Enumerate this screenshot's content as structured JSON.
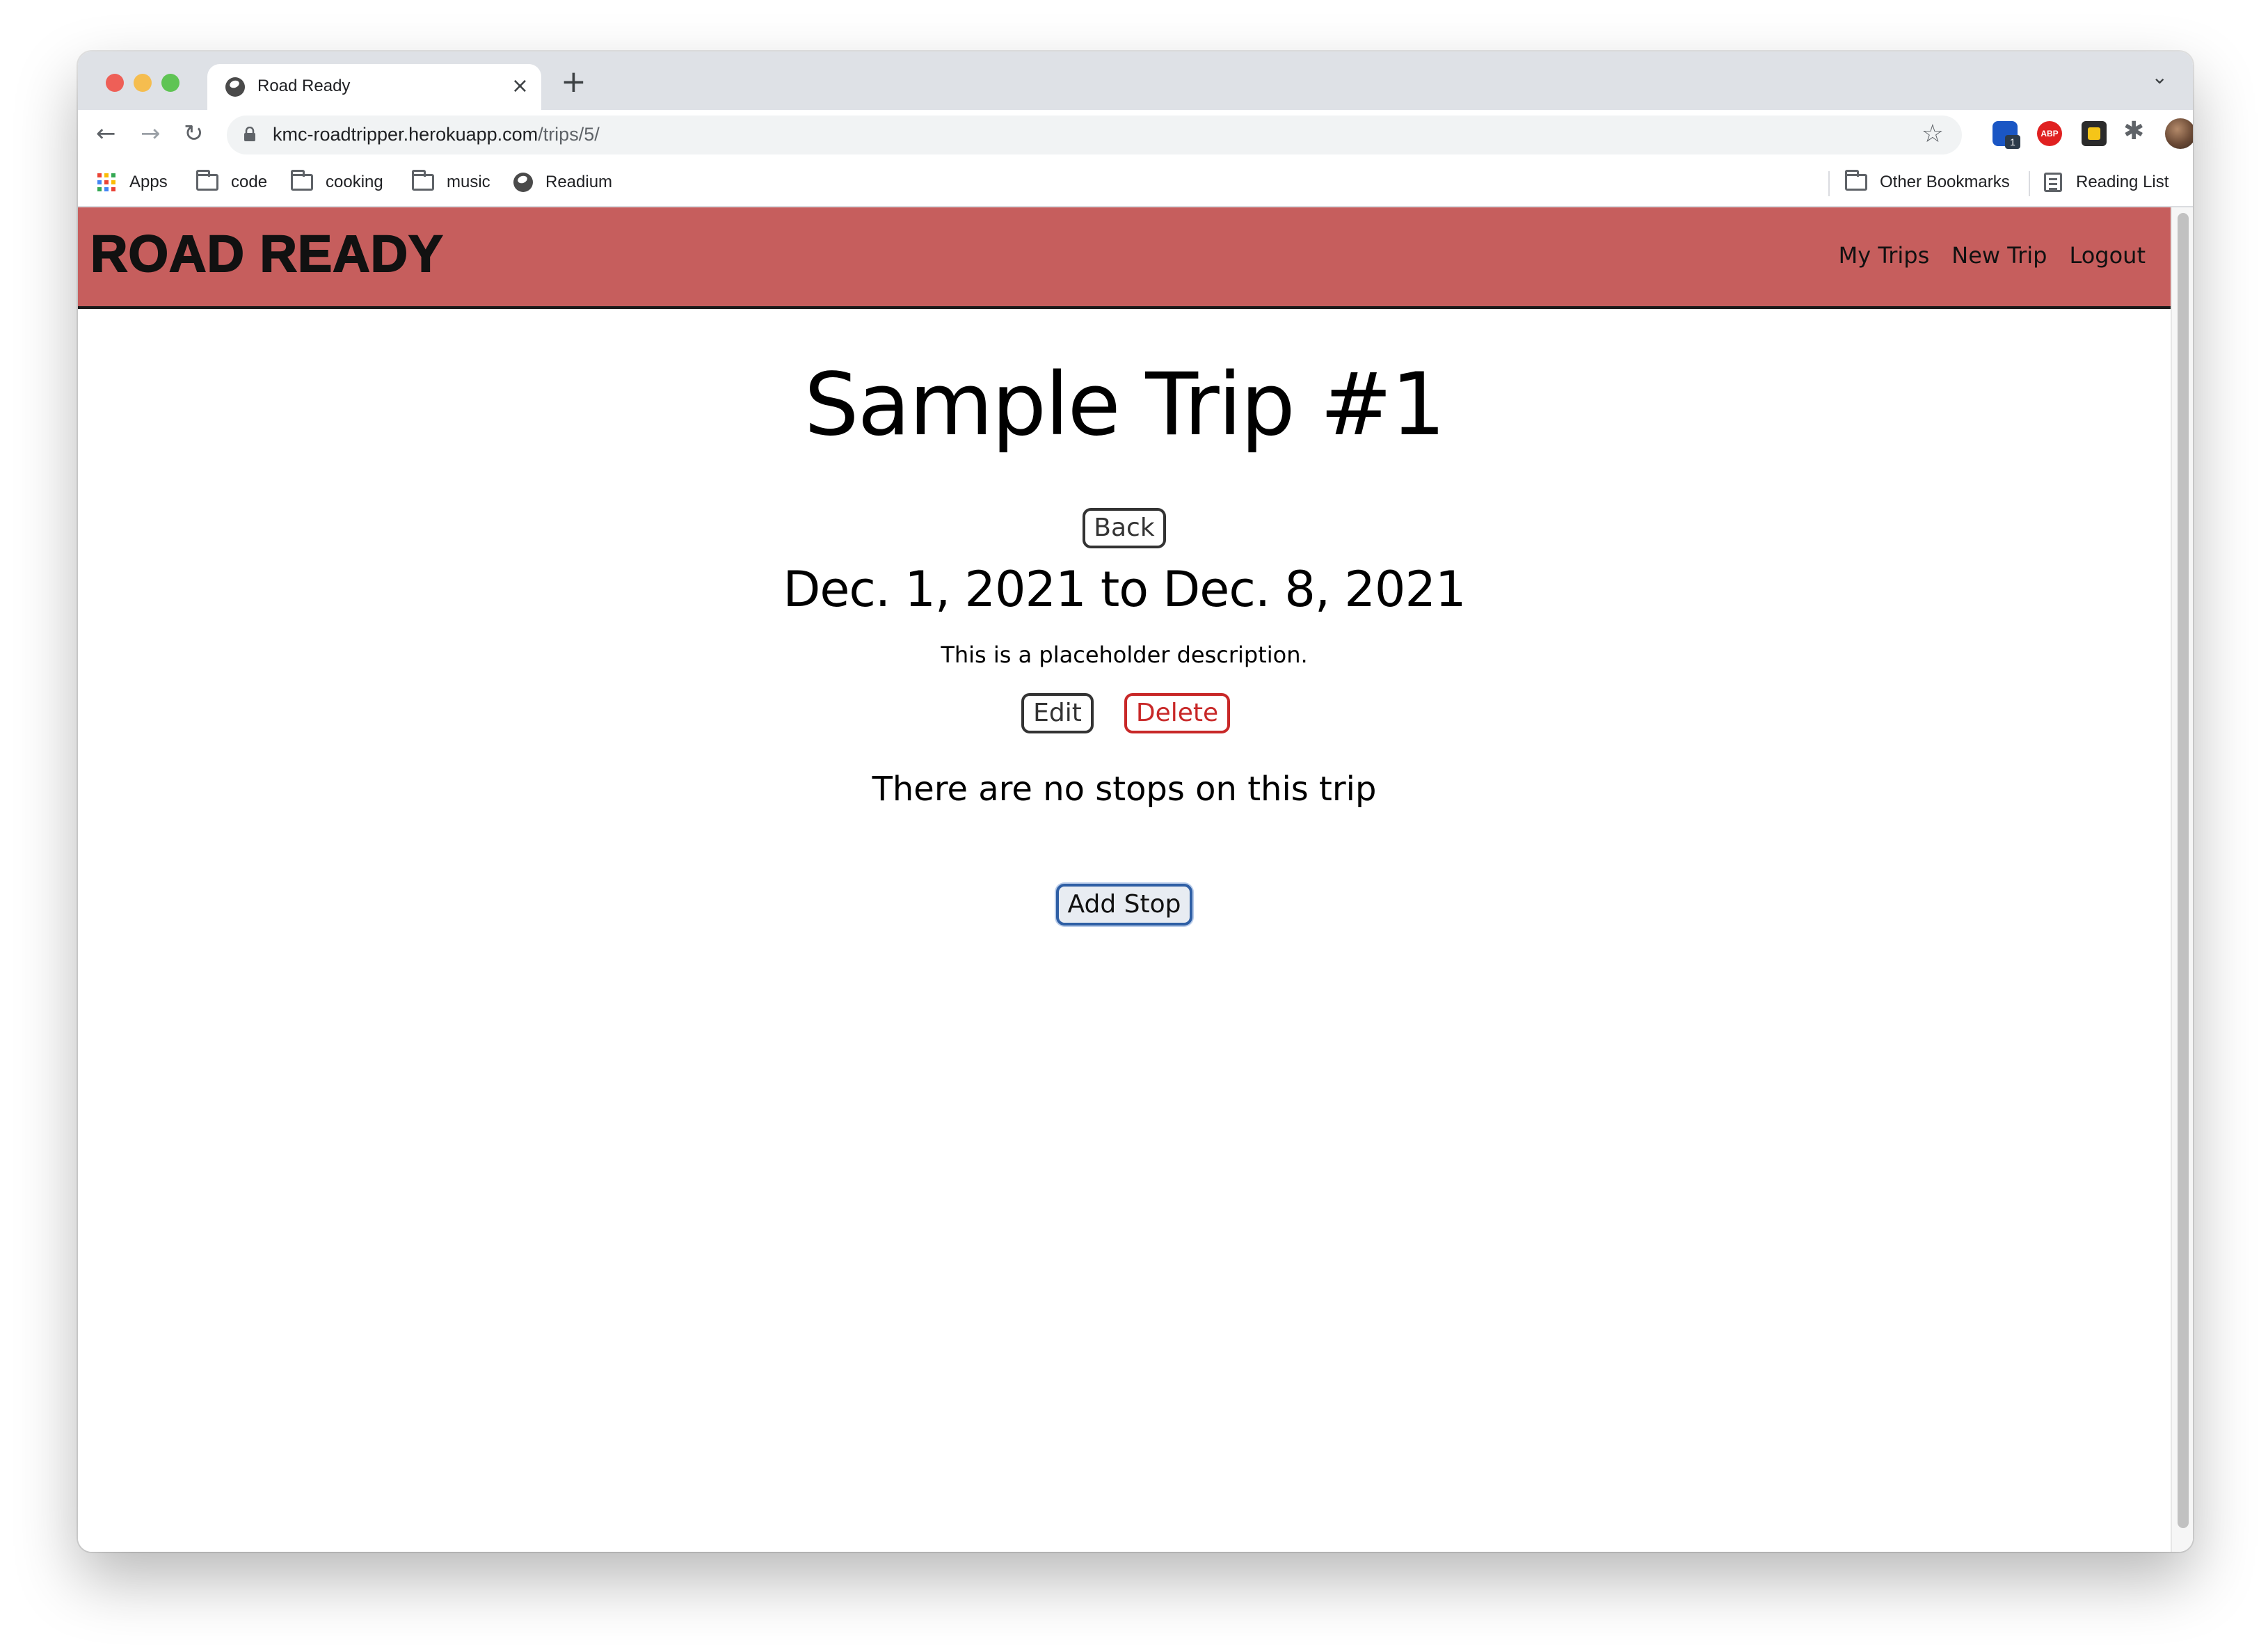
{
  "browser": {
    "tab_title": "Road Ready",
    "tab_close": "×",
    "new_tab": "+",
    "tab_menu": "⌄",
    "url_host": "kmc-roadtripper.herokuapp.com",
    "url_path": "/trips/5/",
    "back_glyph": "←",
    "forward_glyph": "→",
    "reload_glyph": "↻",
    "star_glyph": "☆",
    "puzzle_glyph": "✱",
    "kebab_glyph": "⋮",
    "ext_badge": "1",
    "ext_abp": "ABP"
  },
  "bookmarks": {
    "apps": "Apps",
    "code": "code",
    "cooking": "cooking",
    "music": "music",
    "readium": "Readium",
    "other": "Other Bookmarks",
    "reading_list": "Reading List"
  },
  "site": {
    "logo": "ROAD READY",
    "nav": {
      "my_trips": "My Trips",
      "new_trip": "New Trip",
      "logout": "Logout"
    }
  },
  "trip": {
    "title": "Sample Trip #1",
    "back_label": "Back",
    "dates": "Dec. 1, 2021 to Dec. 8, 2021",
    "description": "This is a placeholder description.",
    "edit_label": "Edit",
    "delete_label": "Delete",
    "no_stops": "There are no stops on this trip",
    "add_stop_label": "Add Stop"
  },
  "colors": {
    "header_bg": "#c65e5d",
    "delete_accent": "#c82828",
    "add_stop_border": "#2f5fa5"
  }
}
